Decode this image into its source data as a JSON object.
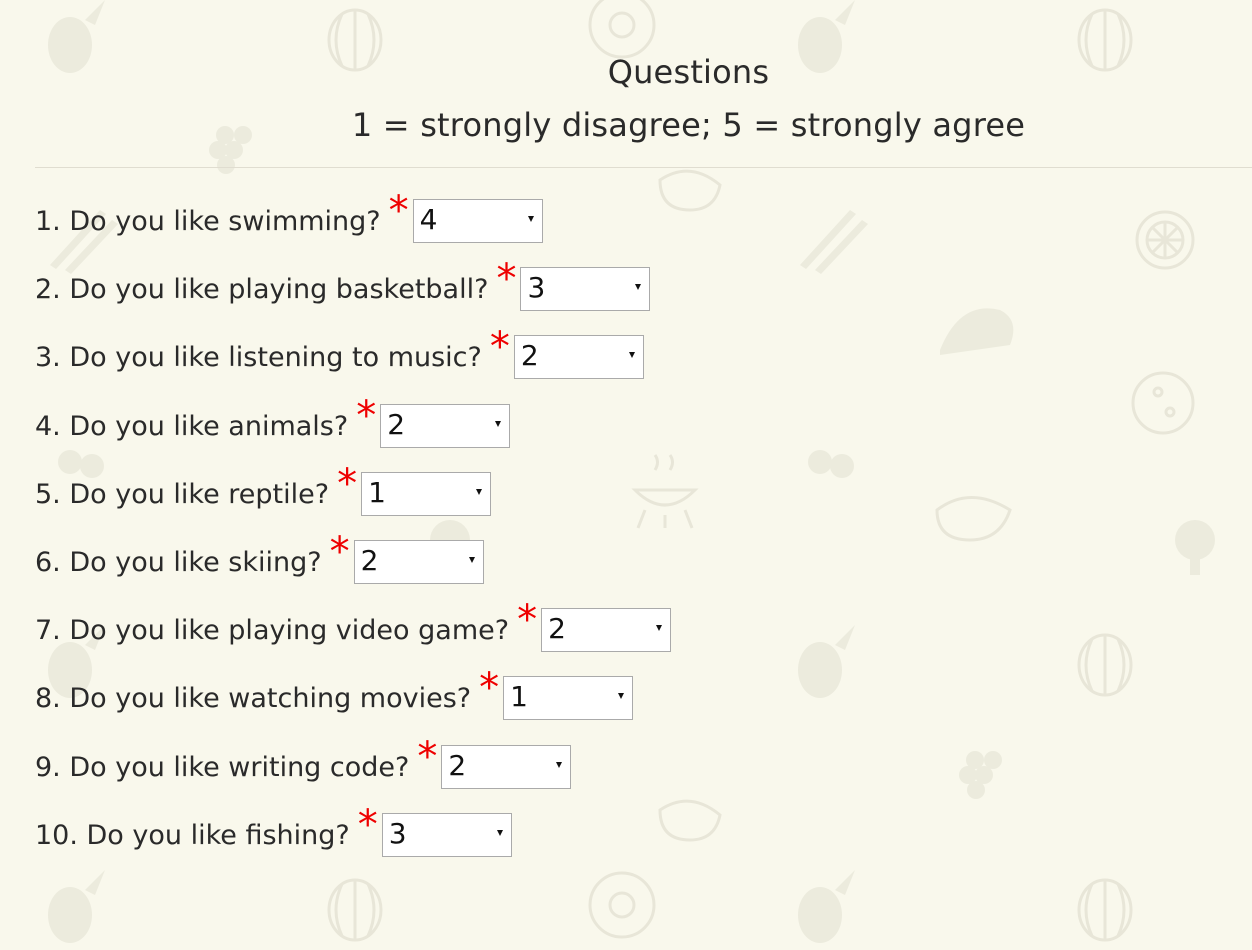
{
  "header": {
    "title": "Questions",
    "subtitle": "1 = strongly disagree; 5 = strongly agree"
  },
  "questions": [
    {
      "label": "1. Do you like swimming?",
      "required": "*",
      "value": "4"
    },
    {
      "label": "2. Do you like playing basketball?",
      "required": "*",
      "value": "3"
    },
    {
      "label": "3. Do you like listening to music?",
      "required": "*",
      "value": "2"
    },
    {
      "label": "4. Do you like animals?",
      "required": "*",
      "value": "2"
    },
    {
      "label": "5. Do you like reptile?",
      "required": "*",
      "value": "1"
    },
    {
      "label": "6. Do you like skiing?",
      "required": "*",
      "value": "2"
    },
    {
      "label": "7. Do you like playing video game?",
      "required": "*",
      "value": "2"
    },
    {
      "label": "8. Do you like watching movies?",
      "required": "*",
      "value": "1"
    },
    {
      "label": "9. Do you like writing code?",
      "required": "*",
      "value": "2"
    },
    {
      "label": "10. Do you like fishing?",
      "required": "*",
      "value": "3"
    }
  ],
  "colors": {
    "background": "#f9f8ec",
    "required_star": "#ee0000",
    "text": "#2a2a2a"
  },
  "background_icons": [
    "pineapple-icon",
    "watermelon-icon",
    "donut-icon",
    "grapes-icon",
    "steak-icon",
    "asparagus-icon",
    "chicken-icon",
    "cherry-icon",
    "grill-icon",
    "broccoli-icon",
    "pizza-icon",
    "citrus-icon"
  ]
}
